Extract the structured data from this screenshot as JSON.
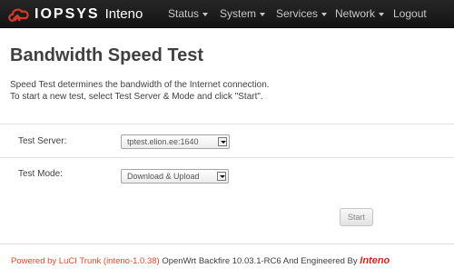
{
  "brand": {
    "name": "IOPSYS",
    "sub": "Inteno"
  },
  "nav": [
    {
      "label": "Status"
    },
    {
      "label": "System"
    },
    {
      "label": "Services"
    },
    {
      "label": "Network"
    },
    {
      "label": "Logout"
    }
  ],
  "page": {
    "title": "Bandwidth Speed Test",
    "desc_line1": "Speed Test determines the bandwidth of the Internet connection.",
    "desc_line2": "To start a new test, select Test Server & Mode and click \"Start\"."
  },
  "form": {
    "server_label": "Test Server:",
    "server_value": "tptest.elion.ee:1640",
    "mode_label": "Test Mode:",
    "mode_value": "Download & Upload",
    "start_label": "Start"
  },
  "footer": {
    "powered": "Powered by LuCI Trunk (inteno-1.0.38)",
    "rest": " OpenWrt Backfire 10.03.1-RC6 And Engineered By ",
    "logo": "Inteno"
  },
  "colors": {
    "navbar": "#1b1b1b",
    "accent": "#e04b2b"
  }
}
